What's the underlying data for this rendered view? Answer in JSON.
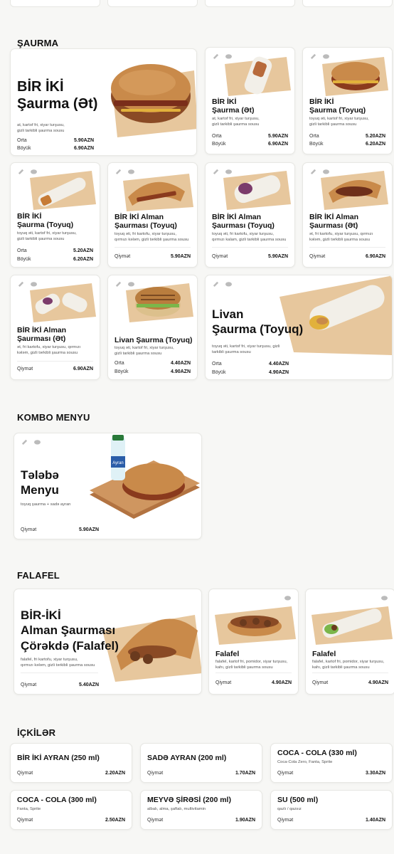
{
  "sections": {
    "saurma": "ŞAURMA",
    "kombo": "KOMBO MENYU",
    "falafel": "FALAFEL",
    "ickiler": "İÇKİLƏR"
  },
  "saurma_items": [
    {
      "title": "BİR İKİ\nŞaurma (Ət)",
      "desc": "at, kartof fri, xiyar turşusu,\ngizli tarkibli şaurma sousu",
      "prices": [
        {
          "label": "Orta",
          "price": "5.90AZN"
        },
        {
          "label": "Böyük",
          "price": "6.90AZN"
        }
      ]
    },
    {
      "title": "BİR İKİ\nŞaurma (Ət)",
      "desc": "at, kartof fri, xiyar turşusu,\ngizli tarkibli şaurma sousu",
      "prices": [
        {
          "label": "Orta",
          "price": "5.90AZN"
        },
        {
          "label": "Böyük",
          "price": "6.90AZN"
        }
      ]
    },
    {
      "title": "BİR İKİ\nŞaurma (Toyuq)",
      "desc": "toyuq əti, kartof fri, xiyar turşusu,\ngizli tarkibli şaurma sousu",
      "prices": [
        {
          "label": "Orta",
          "price": "5.20AZN"
        },
        {
          "label": "Böyük",
          "price": "6.20AZN"
        }
      ]
    },
    {
      "title": "BİR İKİ\nŞaurma (Toyuq)",
      "desc": "toyuq əti, kartof fri, xiyar turşusu,\ngizli tarkibli şaurma sousu",
      "prices": [
        {
          "label": "Orta",
          "price": "5.20AZN"
        },
        {
          "label": "Böyük",
          "price": "6.20AZN"
        }
      ]
    },
    {
      "title": "BİR İKİ Alman\nŞaurması (Toyuq)",
      "desc": "toyuq əti, fri kartofu, xiyar turşusu,\nqırmızı kələm, gizli tərkibli şaurma sousu",
      "prices": [
        {
          "label": "Qiymət",
          "price": "5.90AZN"
        }
      ]
    },
    {
      "title": "BİR İKİ Alman\nŞaurması (Toyuq)",
      "desc": "toyuq əti, fri kartofu, xiyar turşusu,\nqırmızı kalam, gizli tarkibli şaurma sousu",
      "prices": [
        {
          "label": "Qiymət",
          "price": "5.90AZN"
        }
      ]
    },
    {
      "title": "BİR İKİ Alman\nŞaurması (Ət)",
      "desc": "ət, fri kartofu, xiyar turşusu, qırmızı\nkələm, gizli tərkibli şaurma sousu",
      "prices": [
        {
          "label": "Qiymət",
          "price": "6.90AZN"
        }
      ]
    },
    {
      "title": "BİR İKİ Alman\nŞaurması (Ət)",
      "desc": "ət, fri kartofu, xiyar turşusu, qırmızı\nkələm, gizli tərkibli şaurma sousu",
      "prices": [
        {
          "label": "Qiymət",
          "price": "6.90AZN"
        }
      ]
    },
    {
      "title": "Livan Şaurma (Toyuq)",
      "desc": "toyuq əti, kartof fri, xiyar turşusu,\ngizli tarkibli şaurma sousu",
      "prices": [
        {
          "label": "Orta",
          "price": "4.40AZN"
        },
        {
          "label": "Böyük",
          "price": "4.90AZN"
        }
      ]
    },
    {
      "title": "Livan\nŞaurma (Toyuq)",
      "desc": "toyuq əti, kartof fri, xiyar turşusu, gizli\ntarkibli şaurma sousu",
      "prices": [
        {
          "label": "Orta",
          "price": "4.40AZN"
        },
        {
          "label": "Böyük",
          "price": "4.90AZN"
        }
      ]
    }
  ],
  "kombo_items": [
    {
      "title": "Tələbə\nMenyu",
      "desc": "toyuq şaurma + sadə ayran",
      "prices": [
        {
          "label": "Qiymət",
          "price": "5.90AZN"
        }
      ],
      "bottle_label": "Ayran"
    }
  ],
  "falafel_items": [
    {
      "title": "BİR-İKİ\nAlman Şaurması\nÇörəkdə (Falafel)",
      "desc": "falafel, fri kartofu, xiyar turşusu,\nqırmızı kələm, gizli tərkibli şaurma sousu",
      "prices": [
        {
          "label": "Qiymət",
          "price": "5.40AZN"
        }
      ]
    },
    {
      "title": "Falafel",
      "desc": "falafel, kartof fri, pomidor, xiyar turşusu,\nkahı, gizli tarkibli şaurma sousu",
      "prices": [
        {
          "label": "Qiymət",
          "price": "4.90AZN"
        }
      ]
    },
    {
      "title": "Falafel",
      "desc": "falafel, kartof fri, pomidor, xiyar turşusu,\nkahı, gizli tarkibli şaurma sousu",
      "prices": [
        {
          "label": "Qiymət",
          "price": "4.90AZN"
        }
      ]
    }
  ],
  "drink_items": [
    {
      "title": "BİR İKİ AYRAN (250 ml)",
      "desc": "",
      "prices": [
        {
          "label": "Qiymət",
          "price": "2.20AZN"
        }
      ]
    },
    {
      "title": "SADƏ AYRAN (200 ml)",
      "desc": "",
      "prices": [
        {
          "label": "Qiymət",
          "price": "1.70AZN"
        }
      ]
    },
    {
      "title": "COCA - COLA (330 ml)",
      "desc": "Coca-Cola Zero, Fanta, Sprite",
      "prices": [
        {
          "label": "Qiymət",
          "price": "3.30AZN"
        }
      ]
    },
    {
      "title": "COCA - COLA (300 ml)",
      "desc": "Fanta, Sprite",
      "prices": [
        {
          "label": "Qiymət",
          "price": "2.50AZN"
        }
      ]
    },
    {
      "title": "MEYVƏ ŞİRƏSİ (200 ml)",
      "desc": "albalı, alma, şaftalı, multivitamin",
      "prices": [
        {
          "label": "Qiymət",
          "price": "1.90AZN"
        }
      ]
    },
    {
      "title": "SU (500 ml)",
      "desc": "qazlı / qazsız",
      "prices": [
        {
          "label": "Qiymət",
          "price": "1.40AZN"
        }
      ]
    }
  ],
  "icons": [
    "pepper-icon",
    "cloud-icon"
  ],
  "colors": {
    "background": "#f7f7f5",
    "card": "#ffffff",
    "kraft_paper": "#e8c9a0",
    "bread": "#c98a4a",
    "text": "#111111"
  }
}
